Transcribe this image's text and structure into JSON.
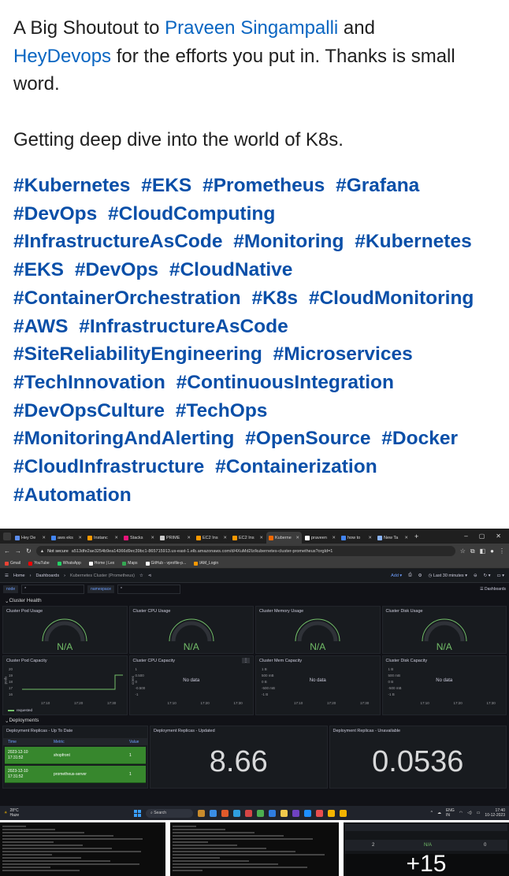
{
  "post": {
    "line1_prefix": "A Big Shoutout to ",
    "person_link": "Praveen Singampalli",
    "line1_mid": " and",
    "org_link": "HeyDevops",
    "line1_suffix": " for the efforts you put in. Thanks is small word.",
    "line2": "Getting deep dive into the world of K8s.",
    "hashtags": [
      "#Kubernetes",
      "#EKS",
      "#Prometheus",
      "#Grafana",
      "#DevOps",
      "#CloudComputing",
      "#InfrastructureAsCode",
      "#Monitoring",
      "#Kubernetes",
      "#EKS",
      "#DevOps",
      "#CloudNative",
      "#ContainerOrchestration",
      "#K8s",
      "#CloudMonitoring",
      "#AWS",
      "#InfrastructureAsCode",
      "#SiteReliabilityEngineering",
      "#Microservices",
      "#TechInnovation",
      "#ContinuousIntegration",
      "#DevOpsCulture",
      "#TechOps",
      "#MonitoringAndAlerting",
      "#OpenSource",
      "#Docker",
      "#CloudInfrastructure",
      "#Containerization",
      "#Automation"
    ]
  },
  "screenshot": {
    "tabs": [
      {
        "label": "Hey De",
        "color": "#5b8def"
      },
      {
        "label": "aws eks",
        "color": "#4285f4"
      },
      {
        "label": "Instanc",
        "color": "#ff9900"
      },
      {
        "label": "Stacks",
        "color": "#e7157b"
      },
      {
        "label": "PRIME",
        "color": "#cccccc"
      },
      {
        "label": "EC2 Ins",
        "color": "#ff9900"
      },
      {
        "label": "EC2 Ins",
        "color": "#ff9900"
      },
      {
        "label": "Kuberne",
        "color": "#f46800",
        "active": true
      },
      {
        "label": "praveen",
        "color": "#ffffff"
      },
      {
        "label": "how to",
        "color": "#4285f4"
      },
      {
        "label": "New Ta",
        "color": "#8ab4f8"
      }
    ],
    "security_label": "Not secure",
    "url": "a513dfe2ae3254b9ea14366d9ec39bc1-865715913.us-east-1.elb.amazonaws.com/d/4XuMd2Iz/kubernetes-cluster-prometheus?orgId=1",
    "bookmarks": [
      {
        "label": "Gmail",
        "color": "#ea4335"
      },
      {
        "label": "YouTube",
        "color": "#ff0000"
      },
      {
        "label": "WhatsApp",
        "color": "#25d366"
      },
      {
        "label": "Home | Lex",
        "color": "#ffffff"
      },
      {
        "label": "Maps",
        "color": "#34a853"
      },
      {
        "label": "GitHub - vprofile-p...",
        "color": "#ffffff"
      },
      {
        "label": "IAM_Login",
        "color": "#ff9900"
      }
    ],
    "breadcrumb": [
      "Home",
      "Dashboards",
      "Kubernetes Cluster (Prometheus)"
    ],
    "add_label": "Add",
    "time_range": "Last 30 minutes",
    "variables": {
      "node_label": "node",
      "node_value": "*",
      "namespace_label": "namespace",
      "namespace_value": "*"
    },
    "dashboards_link": "Dashboards",
    "cluster_health_title": "Cluster Health",
    "gauges": [
      {
        "title": "Cluster Pod Usage",
        "value": "N/A"
      },
      {
        "title": "Cluster CPU Usage",
        "value": "N/A"
      },
      {
        "title": "Cluster Memory Usage",
        "value": "N/A"
      },
      {
        "title": "Cluster Disk Usage",
        "value": "N/A"
      }
    ],
    "capacity": [
      {
        "title": "Cluster Pod Capacity",
        "yticks": [
          "20",
          "19",
          "18",
          "17",
          "16"
        ],
        "ylabel": "pods",
        "xticks": [
          "17:10",
          "17:20",
          "17:30"
        ],
        "legend": "requested",
        "nodata": ""
      },
      {
        "title": "Cluster CPU Capacity",
        "yticks": [
          "1",
          "0.500",
          "0",
          "-0.500",
          "-1"
        ],
        "ylabel": "cores",
        "xticks": [
          "17:10",
          "17:20",
          "17:30"
        ],
        "legend": "",
        "nodata": "No data"
      },
      {
        "title": "Cluster Mem Capacity",
        "yticks": [
          "1 B",
          "500 mB",
          "0 B",
          "-500 mB",
          "-1 B"
        ],
        "ylabel": "",
        "xticks": [
          "17:10",
          "17:20",
          "17:30"
        ],
        "legend": "",
        "nodata": "No data"
      },
      {
        "title": "Cluster Disk Capacity",
        "yticks": [
          "1 B",
          "500 mB",
          "0 B",
          "-500 mB",
          "-1 B"
        ],
        "ylabel": "",
        "xticks": [
          "17:10",
          "17:20",
          "17:30"
        ],
        "legend": "",
        "nodata": "No data"
      }
    ],
    "deployments_title": "Deployments",
    "replicas_table": {
      "title": "Deployment Replicas - Up To Date",
      "columns": [
        "Time",
        "Metric",
        "Value"
      ],
      "rows": [
        {
          "time": "2023-12-10 17:31:52",
          "metric": "shopfront",
          "value": "1"
        },
        {
          "time": "2023-12-10 17:31:52",
          "metric": "prometheus-server",
          "value": "1"
        }
      ]
    },
    "updated": {
      "title": "Deployment Replicas - Updated",
      "value": "8.66"
    },
    "unavailable": {
      "title": "Deployment Replicas - Unavailable",
      "value": "0.0536"
    },
    "taskbar": {
      "weather_temp": "28°C",
      "weather_desc": "Haze",
      "search_label": "Search",
      "lang_top": "ENG",
      "lang_bottom": "IN",
      "time": "17:40",
      "date": "10-12-2023"
    }
  },
  "thumbnails": {
    "third_values": [
      "2",
      "N/A",
      "0"
    ],
    "more_count": "+15"
  }
}
